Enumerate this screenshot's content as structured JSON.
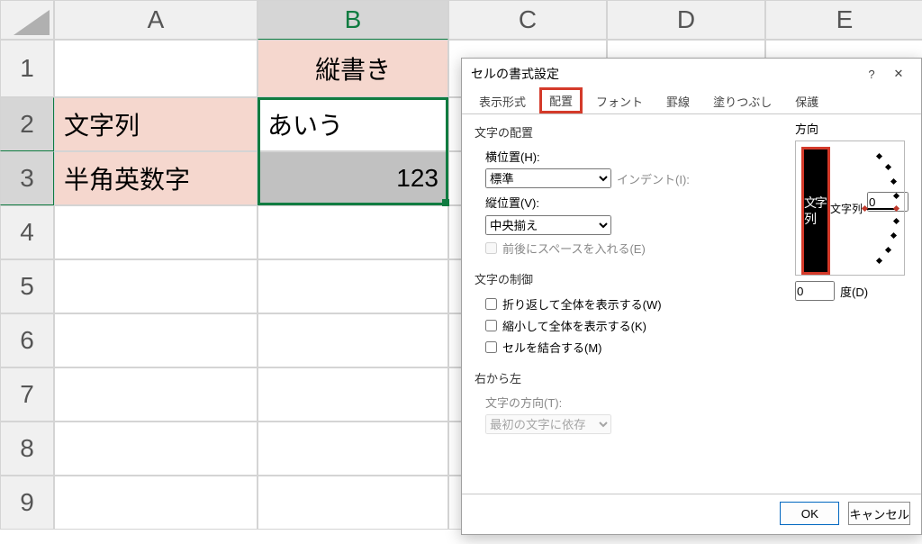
{
  "sheet": {
    "columns": [
      "A",
      "B",
      "C",
      "D",
      "E"
    ],
    "rows": [
      "1",
      "2",
      "3",
      "4",
      "5",
      "6",
      "7",
      "8",
      "9"
    ],
    "selected_columns": [
      "B"
    ],
    "selected_rows": [
      "2",
      "3"
    ],
    "cells": {
      "B1": "縦書き",
      "A2": "文字列",
      "A3": "半角英数字",
      "B2": "あいう",
      "B3": "123"
    }
  },
  "dialog": {
    "title": "セルの書式設定",
    "help_icon": "?",
    "close_icon": "✕",
    "tabs": [
      "表示形式",
      "配置",
      "フォント",
      "罫線",
      "塗りつぶし",
      "保護"
    ],
    "active_tab": "配置",
    "alignment": {
      "group": "文字の配置",
      "horiz_label": "横位置(H):",
      "horiz_value": "標準",
      "indent_label": "インデント(I):",
      "indent_value": "0",
      "vert_label": "縦位置(V):",
      "vert_value": "中央揃え",
      "justify_distributed": "前後にスペースを入れる(E)"
    },
    "text_control": {
      "group": "文字の制御",
      "wrap": "折り返して全体を表示する(W)",
      "shrink": "縮小して全体を表示する(K)",
      "merge": "セルを結合する(M)"
    },
    "rtl": {
      "group": "右から左",
      "dir_label": "文字の方向(T):",
      "dir_value": "最初の文字に依存"
    },
    "orientation": {
      "group": "方向",
      "vertical_pill": "文字列",
      "dial_label": "文字列",
      "degrees_value": "0",
      "degrees_label": "度(D)"
    },
    "buttons": {
      "ok": "OK",
      "cancel": "キャンセル"
    }
  }
}
